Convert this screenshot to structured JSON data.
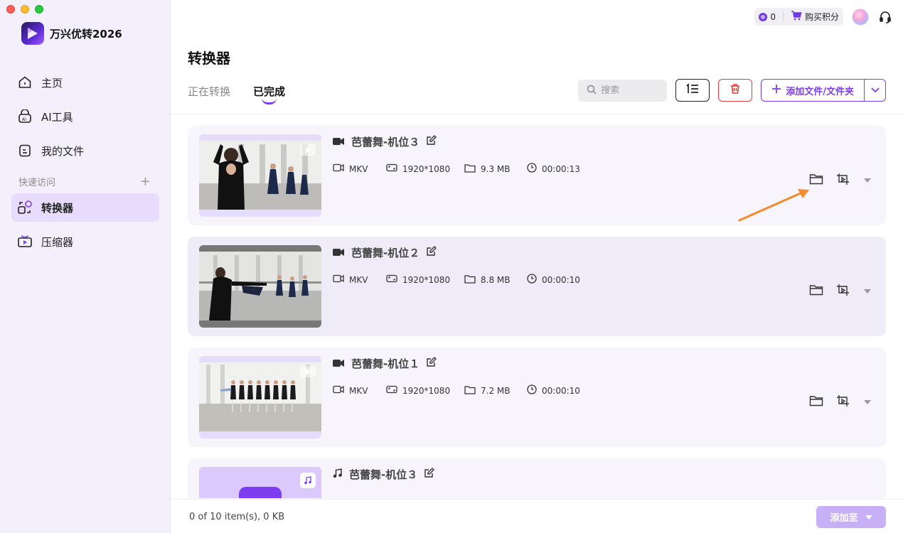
{
  "app": {
    "name": "万兴优转2026",
    "brand_color": "#7c3ef0"
  },
  "sidebar": {
    "items": [
      {
        "label": "主页",
        "icon": "home-icon"
      },
      {
        "label": "AI工具",
        "icon": "ai-tools-icon"
      },
      {
        "label": "我的文件",
        "icon": "file-icon"
      }
    ],
    "quick_access_label": "快速访问",
    "quick_access_add": "+",
    "tools": [
      {
        "label": "转换器",
        "icon": "converter-icon",
        "active": true
      },
      {
        "label": "压缩器",
        "icon": "compressor-icon",
        "active": false
      }
    ]
  },
  "topbar": {
    "credits": "0",
    "buy_credits_label": "购买积分"
  },
  "page": {
    "title": "转换器",
    "tabs": [
      {
        "label": "正在转换",
        "active": false
      },
      {
        "label": "已完成",
        "active": true
      }
    ],
    "search_placeholder": "搜索",
    "add_button_label": "添加文件/文件夹"
  },
  "files": [
    {
      "name": "芭蕾舞-机位３",
      "type": "video",
      "format": "MKV",
      "resolution": "1920*1080",
      "size": "9.3 MB",
      "duration": "00:00:13"
    },
    {
      "name": "芭蕾舞-机位２",
      "type": "video",
      "format": "MKV",
      "resolution": "1920*1080",
      "size": "8.8 MB",
      "duration": "00:00:10"
    },
    {
      "name": "芭蕾舞-机位１",
      "type": "video",
      "format": "MKV",
      "resolution": "1920*1080",
      "size": "7.2 MB",
      "duration": "00:00:10"
    },
    {
      "name": "芭蕾舞-机位３",
      "type": "audio"
    }
  ],
  "footer": {
    "count_text": "0 of 10 item(s), 0 KB",
    "add_to_label": "添加至"
  }
}
